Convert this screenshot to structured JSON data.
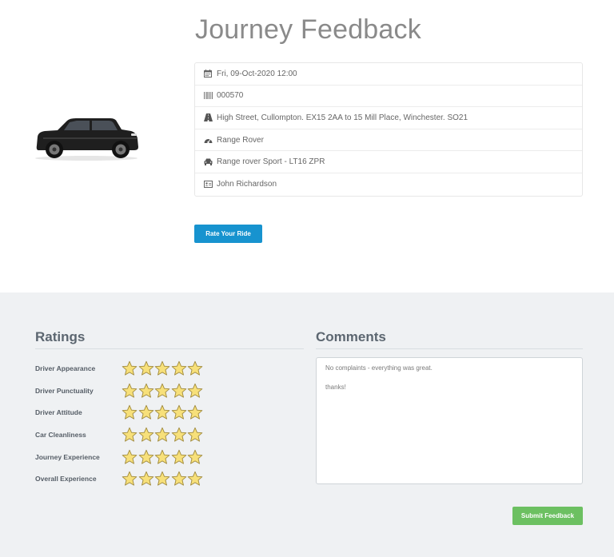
{
  "page": {
    "title": "Journey Feedback"
  },
  "journey": {
    "details": [
      {
        "icon": "calendar-icon",
        "text": "Fri, 09-Oct-2020 12:00"
      },
      {
        "icon": "barcode-icon",
        "text": "000570"
      },
      {
        "icon": "road-icon",
        "text": "High Street, Cullompton. EX15 2AA to 15 Mill Place, Winchester. SO21"
      },
      {
        "icon": "dashboard-icon",
        "text": "Range Rover"
      },
      {
        "icon": "car-icon",
        "text": "Range rover Sport - LT16 ZPR"
      },
      {
        "icon": "id-card-icon",
        "text": "John Richardson"
      }
    ],
    "rate_button": "Rate Your Ride"
  },
  "ratings": {
    "title": "Ratings",
    "max_stars": 5,
    "items": [
      {
        "label": "Driver Appearance",
        "stars": 5
      },
      {
        "label": "Driver Punctuality",
        "stars": 5
      },
      {
        "label": "Driver Attitude",
        "stars": 5
      },
      {
        "label": "Car Cleanliness",
        "stars": 5
      },
      {
        "label": "Journey Experience",
        "stars": 5
      },
      {
        "label": "Overall Experience",
        "stars": 5
      }
    ]
  },
  "comments": {
    "title": "Comments",
    "value": "No complaints - everything was great.\n\nthanks!"
  },
  "submit_button": "Submit Feedback",
  "colors": {
    "rate_button": "#1793cf",
    "submit_button": "#6cc061",
    "star_fill": "#f7e07a",
    "star_stroke": "#a08a3c"
  }
}
